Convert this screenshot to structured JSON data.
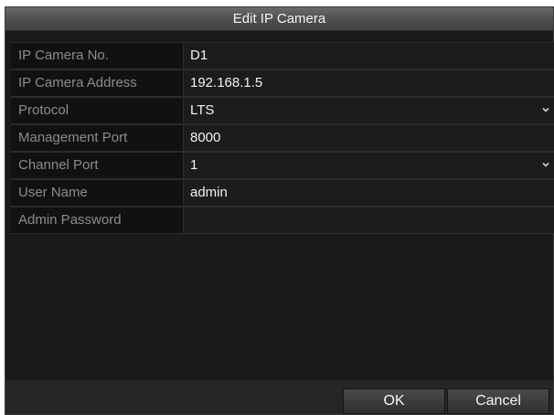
{
  "dialog": {
    "title": "Edit IP Camera"
  },
  "fields": [
    {
      "label": "IP Camera No.",
      "value": "D1",
      "type": "text"
    },
    {
      "label": "IP Camera Address",
      "value": "192.168.1.5",
      "type": "text"
    },
    {
      "label": "Protocol",
      "value": "LTS",
      "type": "select"
    },
    {
      "label": "Management Port",
      "value": "8000",
      "type": "text"
    },
    {
      "label": "Channel Port",
      "value": "1",
      "type": "select"
    },
    {
      "label": "User Name",
      "value": "admin",
      "type": "text"
    },
    {
      "label": "Admin Password",
      "value": "",
      "type": "password"
    }
  ],
  "buttons": {
    "ok_label": "OK",
    "cancel_label": "Cancel"
  },
  "icons": {
    "dropdown": "chevron-down-icon"
  },
  "colors": {
    "background": "#1a1a1a",
    "titlebar": "#555555",
    "label_text": "#8c8c8c",
    "value_text": "#f2f2f2"
  }
}
